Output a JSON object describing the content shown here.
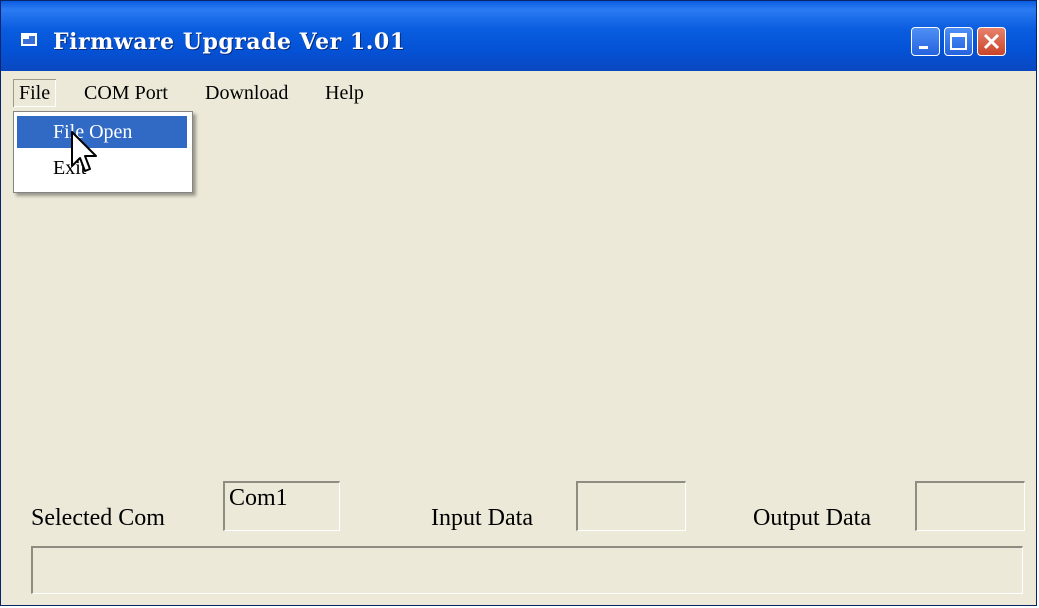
{
  "window": {
    "title": "Firmware Upgrade Ver 1.01",
    "controls": {
      "minimize_icon": "minimize-icon",
      "maximize_icon": "maximize-icon",
      "close_icon": "close-icon"
    }
  },
  "menubar": {
    "file": "File",
    "com_port": "COM Port",
    "download": "Download",
    "help": "Help"
  },
  "file_menu": {
    "items": [
      "File Open",
      "Exit"
    ],
    "highlighted": "File Open"
  },
  "status_row": {
    "selected_com_label": "Selected Com",
    "selected_com_value": "Com1",
    "input_data_label": "Input Data",
    "input_data_value": "",
    "output_data_label": "Output Data",
    "output_data_value": ""
  },
  "status_bar": {
    "text": ""
  },
  "colors": {
    "title_bar": "#0a5ddf",
    "window_face": "#ece9d8",
    "menu_highlight": "#316ac5",
    "close_button": "#c8452a"
  }
}
